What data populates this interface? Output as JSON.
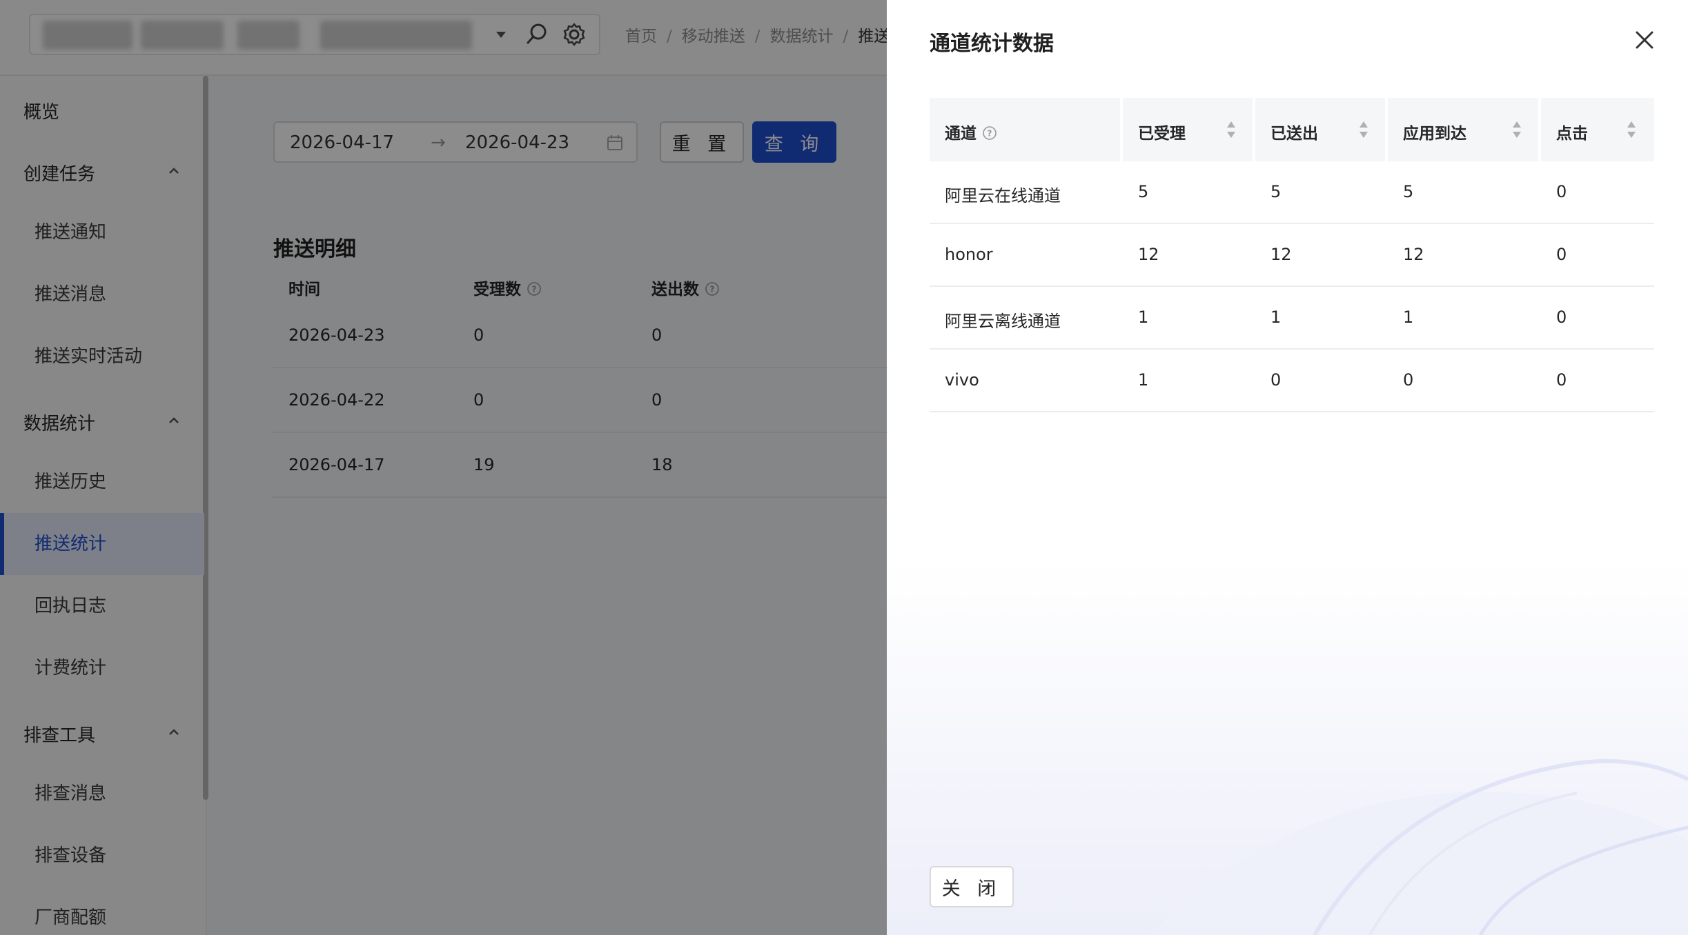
{
  "topbar": {
    "breadcrumb": [
      "首页",
      "移动推送",
      "数据统计",
      "推送"
    ]
  },
  "sidebar": {
    "overview": "概览",
    "groups": [
      {
        "label": "创建任务",
        "items": [
          "推送通知",
          "推送消息",
          "推送实时活动"
        ]
      },
      {
        "label": "数据统计",
        "items": [
          "推送历史",
          "推送统计",
          "回执日志",
          "计费统计"
        ]
      },
      {
        "label": "排查工具",
        "items": [
          "排查消息",
          "排查设备",
          "厂商配额"
        ]
      }
    ],
    "active_item": "推送统计"
  },
  "filter": {
    "start_date": "2026-04-17",
    "end_date": "2026-04-23",
    "reset_label": "重 置",
    "query_label": "查 询"
  },
  "detail": {
    "title": "推送明细",
    "columns": [
      "时间",
      "受理数",
      "送出数"
    ],
    "rows": [
      {
        "date": "2026-04-23",
        "accepted": "0",
        "sent": "0"
      },
      {
        "date": "2026-04-22",
        "accepted": "0",
        "sent": "0"
      },
      {
        "date": "2026-04-17",
        "accepted": "19",
        "sent": "18"
      }
    ]
  },
  "drawer": {
    "title": "通道统计数据",
    "columns": [
      "通道",
      "已受理",
      "已送出",
      "应用到达",
      "点击"
    ],
    "rows": [
      {
        "channel": "阿里云在线通道",
        "accepted": "5",
        "sent": "5",
        "arrived": "5",
        "clicked": "0"
      },
      {
        "channel": "honor",
        "accepted": "12",
        "sent": "12",
        "arrived": "12",
        "clicked": "0"
      },
      {
        "channel": "阿里云离线通道",
        "accepted": "1",
        "sent": "1",
        "arrived": "1",
        "clicked": "0"
      },
      {
        "channel": "vivo",
        "accepted": "1",
        "sent": "0",
        "arrived": "0",
        "clicked": "0"
      }
    ],
    "close_label": "关 闭"
  },
  "colors": {
    "primary": "#1f4fd1",
    "mask": "rgba(0,0,0,0.45)"
  }
}
